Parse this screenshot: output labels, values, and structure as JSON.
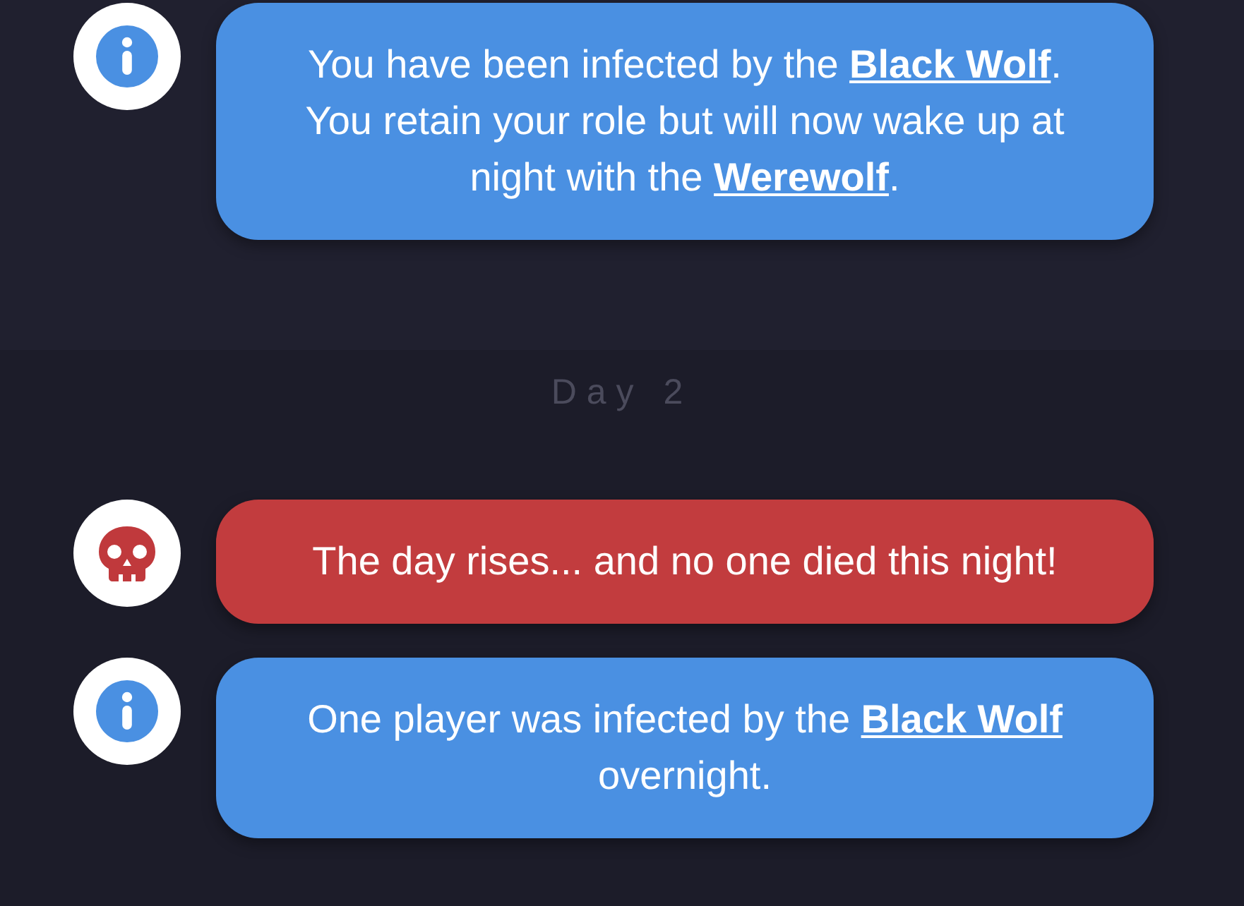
{
  "sections": [
    {
      "kind": "night",
      "messages": [
        {
          "kind": "info",
          "text": "You have been infected by the **Black Wolf**. You retain your role but will now wake up at night with the **Werewolf**."
        }
      ]
    },
    {
      "kind": "day",
      "title": "Day 2",
      "messages": [
        {
          "kind": "death",
          "text": "The day rises... and no one died this night!"
        },
        {
          "kind": "info",
          "text": "One player was infected by the **Black Wolf** overnight."
        }
      ]
    }
  ]
}
